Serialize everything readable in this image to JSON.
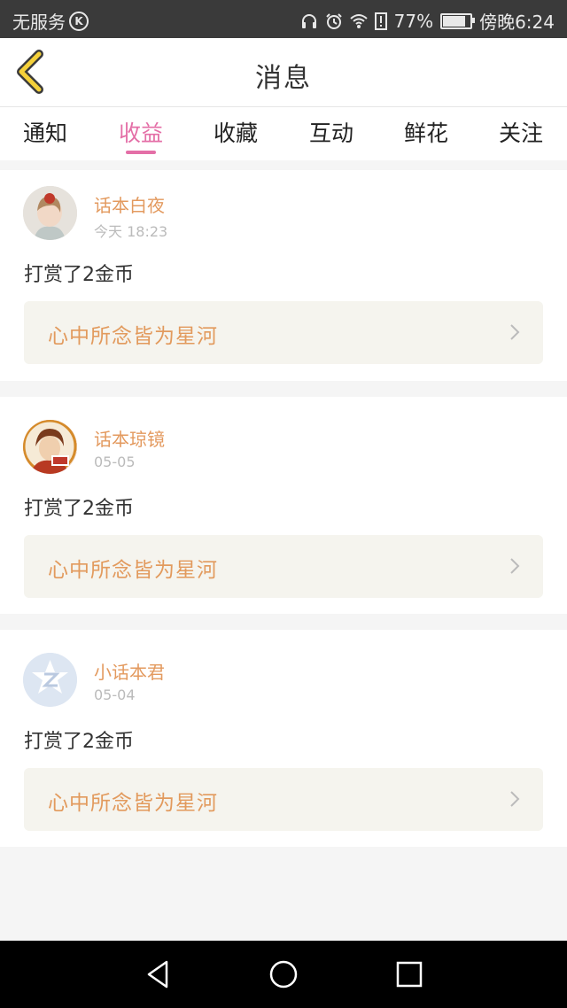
{
  "status_bar": {
    "carrier": "无服务",
    "battery_percent": "77%",
    "battery_level": 0.77,
    "time": "傍晚6:24"
  },
  "header": {
    "title": "消息"
  },
  "tabs": [
    {
      "label": "通知",
      "active": false
    },
    {
      "label": "收益",
      "active": true
    },
    {
      "label": "收藏",
      "active": false
    },
    {
      "label": "互动",
      "active": false
    },
    {
      "label": "鲜花",
      "active": false
    },
    {
      "label": "关注",
      "active": false
    }
  ],
  "messages": [
    {
      "user": "话本白夜",
      "time": "今天 18:23",
      "text": "打赏了2金币",
      "link": "心中所念皆为星河"
    },
    {
      "user": "话本琼镜",
      "time": "05-05",
      "text": "打赏了2金币",
      "link": "心中所念皆为星河"
    },
    {
      "user": "小话本君",
      "time": "05-04",
      "text": "打赏了2金币",
      "link": "心中所念皆为星河"
    }
  ],
  "colors": {
    "accent": "#e46fa7",
    "username": "#e39a5f",
    "link_text": "#e29a5d",
    "link_bg": "#f5f4ee"
  },
  "icons": {
    "back": "back-chevron-icon",
    "link_arrow": "chevron-right-icon",
    "nav": [
      "back-triangle-icon",
      "home-circle-icon",
      "recents-square-icon"
    ]
  }
}
